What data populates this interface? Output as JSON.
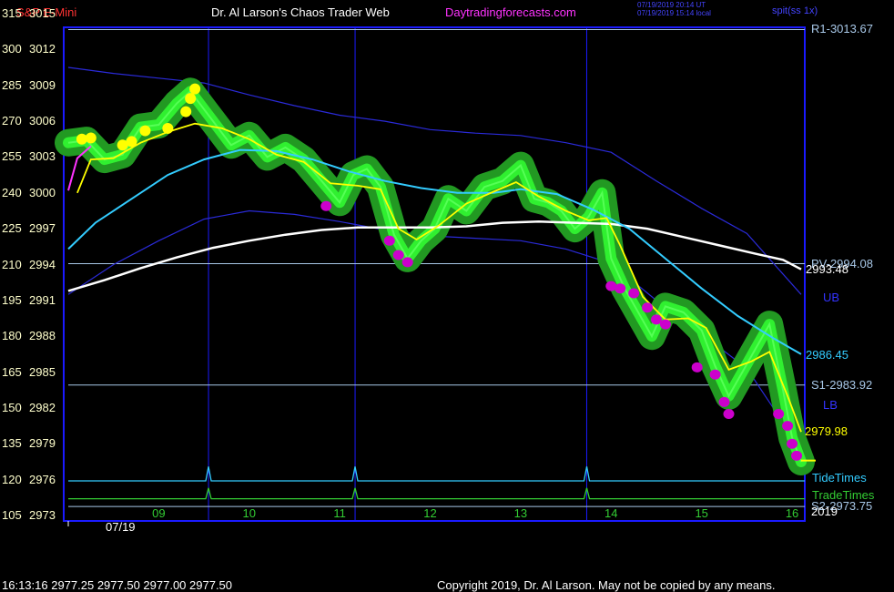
{
  "header": {
    "symbol": "S&P E-Mini",
    "title": "Dr. Al Larson's Chaos Trader Web",
    "site": "Daytradingforecasts.com",
    "stamp_utc": "07/19/2019 20:14 UT",
    "stamp_local": "07/19/2019 15:14 local",
    "version": "spit(ss 1x)"
  },
  "footer": {
    "quote": "16:13:16  2977.25 2977.50 2977.00 2977.50",
    "copyright": "Copyright 2019, Dr. Al Larson. May not be copied by any means."
  },
  "colors": {
    "background": "#000000",
    "frame": "#1a1aff",
    "price": "#33ff33",
    "halo": "#229922",
    "fast_ma": "#ffff00",
    "mid_ma": "#ff33ff",
    "bands": "#2a2ad8",
    "cyan_line": "#33ccff",
    "white_line": "#ffffff",
    "levels": "#a8c8e8",
    "left_axis_text": "#ffffcc",
    "tide": "#33ccff",
    "trade": "#33cc33",
    "dots_high": "#ffff00",
    "dots_low": "#cc00cc",
    "title_symbol": "#ff3333",
    "site_link": "#ff33ff"
  },
  "chart_data": {
    "type": "line",
    "x_labels": [
      "09",
      "10",
      "11",
      "12",
      "13",
      "14",
      "15",
      "16"
    ],
    "x_date_label": "07/19",
    "x_range": [
      8.0,
      16.1
    ],
    "year_label": "2019",
    "y_range": [
      2973,
      3015
    ],
    "y_ticks": [
      {
        "price": 3015,
        "idx": "315"
      },
      {
        "price": 3012,
        "idx": "300"
      },
      {
        "price": 3009,
        "idx": "285"
      },
      {
        "price": 3006,
        "idx": "270"
      },
      {
        "price": 3003,
        "idx": "255"
      },
      {
        "price": 3000,
        "idx": "240"
      },
      {
        "price": 2997,
        "idx": "225"
      },
      {
        "price": 2994,
        "idx": "210"
      },
      {
        "price": 2991,
        "idx": "195"
      },
      {
        "price": 2988,
        "idx": "180"
      },
      {
        "price": 2985,
        "idx": "165"
      },
      {
        "price": 2982,
        "idx": "150"
      },
      {
        "price": 2979,
        "idx": "135"
      },
      {
        "price": 2976,
        "idx": "120"
      },
      {
        "price": 2973,
        "idx": "105"
      }
    ],
    "levels": [
      {
        "label": "R1-3013.67",
        "value": 3013.67
      },
      {
        "label": "PV-2994.08",
        "value": 2994.08
      },
      {
        "label": "S1-2983.92",
        "value": 2983.92
      },
      {
        "label": "S2-2973.75",
        "value": 2973.75
      }
    ],
    "band_labels": [
      {
        "label": "UB",
        "value": 2991.2
      },
      {
        "label": "LB",
        "value": 2982.2
      }
    ],
    "line_end_labels": [
      {
        "label": "2993.48",
        "value": 2993.6
      },
      {
        "label": "2986.45",
        "value": 2986.45
      },
      {
        "label": "2979.98",
        "value": 2979.98
      }
    ],
    "vlines_x": [
      9.55,
      11.17,
      13.73
    ],
    "tide": {
      "label": "TideTimes",
      "baseline": 2975.9,
      "spike_top": 2977.1,
      "spikes_x": [
        9.55,
        11.17,
        13.73
      ]
    },
    "trade": {
      "label": "TradeTimes",
      "baseline": 2974.4,
      "spike_top": 2975.3,
      "spikes_x": [
        9.55,
        11.17,
        13.73
      ]
    },
    "series": [
      {
        "name": "price",
        "points": [
          [
            8.0,
            3004.2
          ],
          [
            8.2,
            3004.4
          ],
          [
            8.4,
            3002.8
          ],
          [
            8.6,
            3003.2
          ],
          [
            8.8,
            3005.5
          ],
          [
            9.0,
            3005.7
          ],
          [
            9.2,
            3007.5
          ],
          [
            9.35,
            3008.5
          ],
          [
            9.5,
            3007.0
          ],
          [
            9.65,
            3005.5
          ],
          [
            9.8,
            3004.0
          ],
          [
            10.0,
            3004.8
          ],
          [
            10.2,
            3003.0
          ],
          [
            10.4,
            3003.8
          ],
          [
            10.6,
            3002.8
          ],
          [
            10.8,
            3001.0
          ],
          [
            11.0,
            2999.2
          ],
          [
            11.15,
            3001.5
          ],
          [
            11.3,
            3002.0
          ],
          [
            11.45,
            3000.5
          ],
          [
            11.6,
            2996.5
          ],
          [
            11.75,
            2994.5
          ],
          [
            11.9,
            2996.0
          ],
          [
            12.05,
            2997.0
          ],
          [
            12.2,
            2999.5
          ],
          [
            12.4,
            2998.5
          ],
          [
            12.6,
            3000.5
          ],
          [
            12.8,
            3001.0
          ],
          [
            13.0,
            3002.3
          ],
          [
            13.15,
            2999.5
          ],
          [
            13.3,
            2999.2
          ],
          [
            13.45,
            2998.5
          ],
          [
            13.6,
            2997.0
          ],
          [
            13.75,
            2998.0
          ],
          [
            13.9,
            3000.0
          ],
          [
            14.0,
            2994.5
          ],
          [
            14.15,
            2992.0
          ],
          [
            14.3,
            2990.0
          ],
          [
            14.45,
            2988.0
          ],
          [
            14.6,
            2990.5
          ],
          [
            14.8,
            2990.0
          ],
          [
            15.0,
            2988.5
          ],
          [
            15.15,
            2985.5
          ],
          [
            15.3,
            2983.0
          ],
          [
            15.45,
            2985.0
          ],
          [
            15.6,
            2987.0
          ],
          [
            15.75,
            2989.0
          ],
          [
            15.9,
            2983.5
          ],
          [
            16.0,
            2979.5
          ],
          [
            16.1,
            2977.5
          ]
        ]
      },
      {
        "name": "fast",
        "points": [
          [
            8.1,
            3000.0
          ],
          [
            8.25,
            3002.8
          ],
          [
            8.5,
            3002.9
          ],
          [
            8.8,
            3004.2
          ],
          [
            9.1,
            3005.1
          ],
          [
            9.4,
            3005.8
          ],
          [
            9.7,
            3005.4
          ],
          [
            10.0,
            3004.5
          ],
          [
            10.3,
            3003.2
          ],
          [
            10.6,
            3002.6
          ],
          [
            10.9,
            3000.8
          ],
          [
            11.2,
            3000.6
          ],
          [
            11.45,
            3000.3
          ],
          [
            11.65,
            2997.0
          ],
          [
            11.85,
            2996.1
          ],
          [
            12.1,
            2997.3
          ],
          [
            12.4,
            2999.1
          ],
          [
            12.7,
            3000.1
          ],
          [
            12.95,
            3000.9
          ],
          [
            13.2,
            2999.7
          ],
          [
            13.5,
            2998.5
          ],
          [
            13.75,
            2997.7
          ],
          [
            13.95,
            2997.9
          ],
          [
            14.1,
            2995.6
          ],
          [
            14.35,
            2991.3
          ],
          [
            14.6,
            2989.4
          ],
          [
            14.85,
            2989.5
          ],
          [
            15.05,
            2988.7
          ],
          [
            15.3,
            2985.2
          ],
          [
            15.55,
            2985.9
          ],
          [
            15.75,
            2986.7
          ],
          [
            15.95,
            2983.0
          ],
          [
            16.1,
            2980.0
          ]
        ]
      },
      {
        "name": "mid",
        "points": [
          [
            8.0,
            3000.2
          ],
          [
            8.1,
            3002.9
          ],
          [
            8.25,
            3003.9
          ]
        ]
      },
      {
        "name": "cyan",
        "points": [
          [
            8.0,
            2995.3
          ],
          [
            8.3,
            2997.5
          ],
          [
            8.7,
            2999.5
          ],
          [
            9.1,
            3001.5
          ],
          [
            9.5,
            3002.8
          ],
          [
            9.9,
            3003.6
          ],
          [
            10.3,
            3003.5
          ],
          [
            10.7,
            3002.8
          ],
          [
            11.1,
            3001.8
          ],
          [
            11.5,
            3001.0
          ],
          [
            11.9,
            3000.4
          ],
          [
            12.3,
            3000.0
          ],
          [
            12.7,
            3000.0
          ],
          [
            13.0,
            3000.3
          ],
          [
            13.4,
            2999.9
          ],
          [
            13.8,
            2998.6
          ],
          [
            14.2,
            2997.0
          ],
          [
            14.6,
            2994.5
          ],
          [
            15.0,
            2992.0
          ],
          [
            15.4,
            2989.7
          ],
          [
            15.8,
            2987.8
          ],
          [
            16.1,
            2986.5
          ]
        ]
      },
      {
        "name": "white",
        "points": [
          [
            8.0,
            2991.8
          ],
          [
            8.4,
            2992.7
          ],
          [
            8.8,
            2993.7
          ],
          [
            9.2,
            2994.6
          ],
          [
            9.6,
            2995.4
          ],
          [
            10.0,
            2996.0
          ],
          [
            10.4,
            2996.5
          ],
          [
            10.8,
            2996.9
          ],
          [
            11.2,
            2997.1
          ],
          [
            11.6,
            2997.1
          ],
          [
            12.0,
            2997.1
          ],
          [
            12.4,
            2997.2
          ],
          [
            12.8,
            2997.5
          ],
          [
            13.2,
            2997.6
          ],
          [
            13.6,
            2997.5
          ],
          [
            14.0,
            2997.4
          ],
          [
            14.4,
            2997.0
          ],
          [
            14.8,
            2996.3
          ],
          [
            15.2,
            2995.6
          ],
          [
            15.6,
            2994.9
          ],
          [
            15.9,
            2994.4
          ],
          [
            16.1,
            2993.6
          ]
        ]
      },
      {
        "name": "upper_band",
        "points": [
          [
            8.0,
            3010.5
          ],
          [
            8.5,
            3010.0
          ],
          [
            9.0,
            3009.6
          ],
          [
            9.5,
            3009.2
          ],
          [
            10.0,
            3008.2
          ],
          [
            10.5,
            3007.3
          ],
          [
            11.0,
            3006.5
          ],
          [
            11.5,
            3006.0
          ],
          [
            12.0,
            3005.3
          ],
          [
            12.5,
            3005.0
          ],
          [
            13.0,
            3004.8
          ],
          [
            13.5,
            3004.2
          ],
          [
            14.0,
            3003.4
          ],
          [
            14.5,
            3001.0
          ],
          [
            15.0,
            2998.7
          ],
          [
            15.5,
            2996.6
          ],
          [
            16.1,
            2991.5
          ]
        ]
      },
      {
        "name": "lower_band",
        "points": [
          [
            8.0,
            2991.5
          ],
          [
            8.5,
            2994.0
          ],
          [
            9.0,
            2996.0
          ],
          [
            9.5,
            2997.8
          ],
          [
            10.0,
            2998.5
          ],
          [
            10.5,
            2998.2
          ],
          [
            11.0,
            2997.6
          ],
          [
            11.5,
            2996.9
          ],
          [
            12.0,
            2996.4
          ],
          [
            12.5,
            2996.2
          ],
          [
            13.0,
            2996.0
          ],
          [
            13.5,
            2995.3
          ],
          [
            14.0,
            2994.1
          ],
          [
            14.5,
            2991.0
          ],
          [
            15.0,
            2988.2
          ],
          [
            15.5,
            2985.3
          ],
          [
            16.1,
            2978.5
          ]
        ]
      }
    ],
    "dots_high": [
      [
        8.15,
        3004.5
      ],
      [
        8.25,
        3004.6
      ],
      [
        8.6,
        3004.0
      ],
      [
        8.7,
        3004.3
      ],
      [
        8.85,
        3005.2
      ],
      [
        9.1,
        3005.4
      ],
      [
        9.3,
        3006.8
      ],
      [
        9.35,
        3007.9
      ],
      [
        9.4,
        3008.7
      ]
    ],
    "dots_low": [
      [
        10.85,
        2998.9
      ],
      [
        11.55,
        2996.0
      ],
      [
        11.65,
        2994.8
      ],
      [
        11.75,
        2994.2
      ],
      [
        14.0,
        2992.2
      ],
      [
        14.1,
        2992.0
      ],
      [
        14.25,
        2991.6
      ],
      [
        14.4,
        2990.4
      ],
      [
        14.5,
        2989.4
      ],
      [
        14.6,
        2989.0
      ],
      [
        14.95,
        2985.4
      ],
      [
        15.15,
        2984.8
      ],
      [
        15.25,
        2982.5
      ],
      [
        15.3,
        2981.5
      ],
      [
        15.85,
        2981.5
      ],
      [
        15.95,
        2980.5
      ],
      [
        16.0,
        2979.0
      ],
      [
        16.05,
        2978.0
      ]
    ]
  }
}
